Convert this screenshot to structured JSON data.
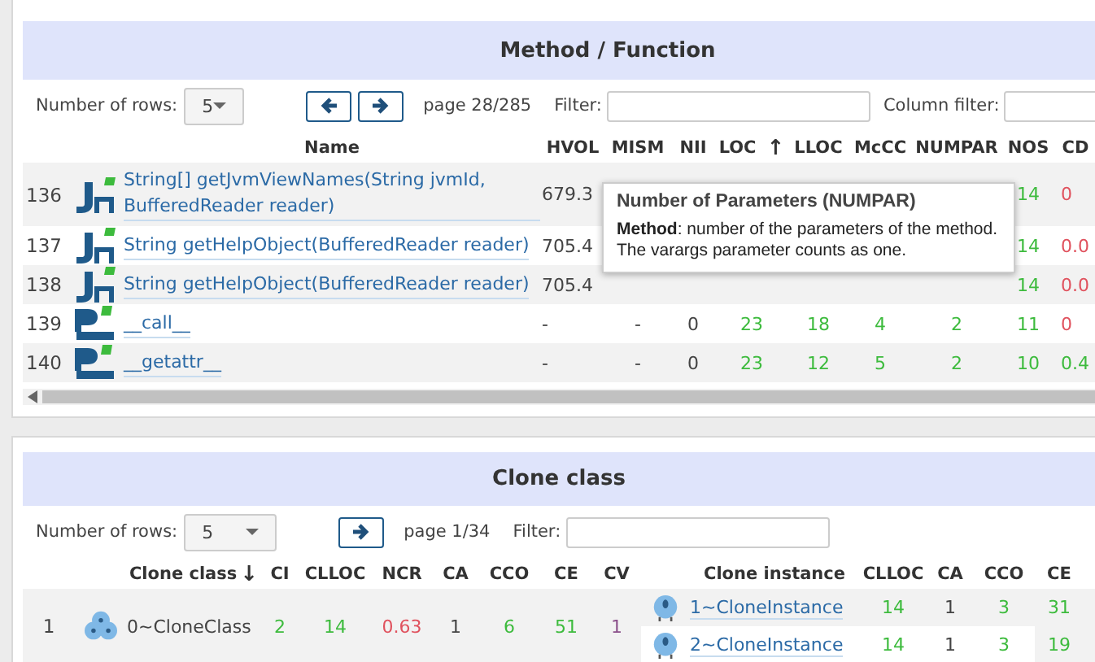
{
  "method_panel": {
    "title": "Method / Function",
    "rows_label": "Number of rows:",
    "rows_value": "5",
    "pager_buttons": [
      {
        "kind": "prev"
      },
      {
        "kind": "next"
      }
    ],
    "page": "page 28/285",
    "filter_label": "Filter:",
    "column_filter_label": "Column filter:",
    "columns": [
      {
        "label": "Name"
      },
      {
        "label": "HVOL"
      },
      {
        "label": "MISM"
      },
      {
        "label": "NII"
      },
      {
        "label": "LOC",
        "sort": "↑"
      },
      {
        "label": "LLOC"
      },
      {
        "label": "McCC"
      },
      {
        "label": "NUMPAR"
      },
      {
        "label": "NOS"
      },
      {
        "label": "CD"
      }
    ],
    "rows": [
      {
        "index": "136",
        "kind": "java",
        "name": "String[] getJvmViewNames(String jvmId, BufferedReader reader)",
        "values": [
          {
            "text": "679.3"
          },
          {
            "text": "14",
            "color": "#3dbb3d"
          },
          {
            "text": "0",
            "color": "#e0525e"
          }
        ]
      },
      {
        "index": "137",
        "kind": "java",
        "name": "String getHelpObject(BufferedReader reader)",
        "values": [
          {
            "text": "705.4"
          },
          {
            "text": "14",
            "color": "#3dbb3d"
          },
          {
            "text": "0.0",
            "color": "#e0525e"
          }
        ]
      },
      {
        "index": "138",
        "kind": "java",
        "name": "String getHelpObject(BufferedReader reader)",
        "values": [
          {
            "text": "705.4"
          },
          {
            "text": "14",
            "color": "#3dbb3d"
          },
          {
            "text": "0.0",
            "color": "#e0525e"
          }
        ]
      },
      {
        "index": "139",
        "kind": "python",
        "name": "__call__",
        "values": [
          {
            "text": "-"
          },
          {
            "text": "-"
          },
          {
            "text": "0"
          },
          {
            "text": "23",
            "color": "#3dbb3d"
          },
          {
            "text": "18",
            "color": "#3dbb3d"
          },
          {
            "text": "4",
            "color": "#3dbb3d"
          },
          {
            "text": "2",
            "color": "#3dbb3d"
          },
          {
            "text": "11",
            "color": "#3dbb3d"
          },
          {
            "text": "0",
            "color": "#e0525e"
          }
        ]
      },
      {
        "index": "140",
        "kind": "python",
        "name": "__getattr__",
        "values": [
          {
            "text": "-"
          },
          {
            "text": "-"
          },
          {
            "text": "0"
          },
          {
            "text": "23",
            "color": "#3dbb3d"
          },
          {
            "text": "12",
            "color": "#3dbb3d"
          },
          {
            "text": "5",
            "color": "#3dbb3d"
          },
          {
            "text": "2",
            "color": "#3dbb3d"
          },
          {
            "text": "10",
            "color": "#3dbb3d"
          },
          {
            "text": "0.4",
            "color": "#3dbb3d"
          }
        ]
      }
    ],
    "tooltip": {
      "title": "Number of Parameters (NUMPAR)",
      "body": "**Method**: number of the parameters of the method. The varargs parameter counts as one."
    }
  },
  "clone_panel": {
    "title": "Clone class",
    "rows_label": "Number of rows:",
    "rows_value": "5",
    "pager_buttons": [
      {
        "kind": "next"
      }
    ],
    "page": "page 1/34",
    "filter_label": "Filter:",
    "columns": [
      {
        "label": "Clone class",
        "sort": "↓"
      },
      {
        "label": "CI"
      },
      {
        "label": "CLLOC"
      },
      {
        "label": "NCR"
      },
      {
        "label": "CA"
      },
      {
        "label": "CCO"
      },
      {
        "label": "CE"
      },
      {
        "label": "CV"
      }
    ],
    "instance_columns": [
      {
        "label": "Clone instance"
      },
      {
        "label": "CLLOC"
      },
      {
        "label": "CA"
      },
      {
        "label": "CCO"
      },
      {
        "label": "CE"
      }
    ],
    "rows": [
      {
        "index": "1",
        "name": "0~CloneClass",
        "values": [
          {
            "text": "2",
            "color": "#3dbb3d"
          },
          {
            "text": "14",
            "color": "#3dbb3d"
          },
          {
            "text": "0.63",
            "color": "#e0525e"
          },
          {
            "text": "1"
          },
          {
            "text": "6",
            "color": "#3dbb3d"
          },
          {
            "text": "51",
            "color": "#3dbb3d"
          },
          {
            "text": "1",
            "color": "#8a4f8a"
          }
        ],
        "instances": [
          {
            "name": "1~CloneInstance",
            "values": [
              {
                "text": "14",
                "color": "#3dbb3d"
              },
              {
                "text": "1"
              },
              {
                "text": "3",
                "color": "#3dbb3d"
              },
              {
                "text": "31",
                "color": "#3dbb3d"
              }
            ]
          },
          {
            "name": "2~CloneInstance",
            "values": [
              {
                "text": "14",
                "color": "#3dbb3d"
              },
              {
                "text": "1"
              },
              {
                "text": "3",
                "color": "#3dbb3d"
              },
              {
                "text": "19",
                "color": "#3dbb3d"
              }
            ]
          }
        ]
      }
    ]
  }
}
